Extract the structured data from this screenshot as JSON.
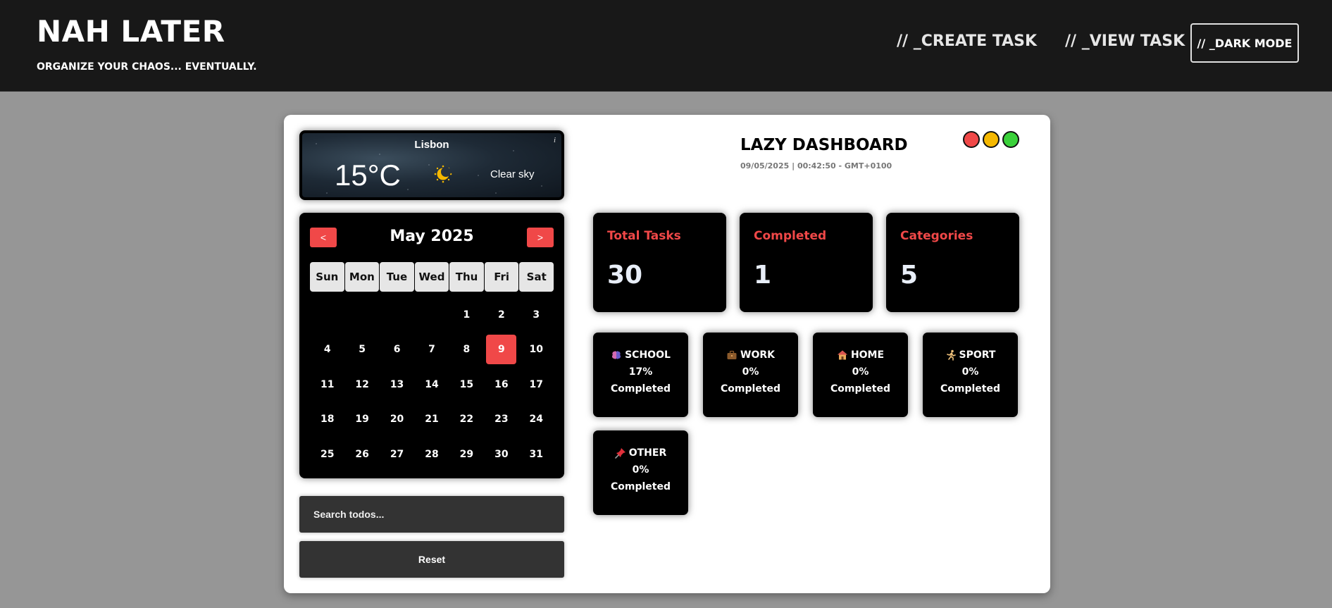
{
  "header": {
    "title": "NAH LATER",
    "tagline": "ORGANIZE YOUR CHAOS... EVENTUALLY.",
    "nav": {
      "create": "// _CREATE TASK",
      "view": "// _VIEW TASK",
      "dark": "// _DARK MODE"
    }
  },
  "weather": {
    "city": "Lisbon",
    "temp": "15°C",
    "description": "Clear sky",
    "icon": "moon-clear-night-icon",
    "info": "i"
  },
  "calendar": {
    "month": "May 2025",
    "prev": "<",
    "next": ">",
    "weekdays": [
      "Sun",
      "Mon",
      "Tue",
      "Wed",
      "Thu",
      "Fri",
      "Sat"
    ],
    "leading_blanks": 4,
    "days": [
      "1",
      "2",
      "3",
      "4",
      "5",
      "6",
      "7",
      "8",
      "9",
      "10",
      "11",
      "12",
      "13",
      "14",
      "15",
      "16",
      "17",
      "18",
      "19",
      "20",
      "21",
      "22",
      "23",
      "24",
      "25",
      "26",
      "27",
      "28",
      "29",
      "30",
      "31"
    ],
    "today": "9"
  },
  "search": {
    "placeholder": "Search todos..."
  },
  "reset_label": "Reset",
  "dashboard": {
    "title": "LAZY DASHBOARD",
    "datetime": "09/05/2025 | 00:42:50 - GMT+0100",
    "window_dots": [
      "#f04848",
      "#f5b800",
      "#3ad13a"
    ]
  },
  "stats": [
    {
      "label": "Total Tasks",
      "value": "30"
    },
    {
      "label": "Completed",
      "value": "1"
    },
    {
      "label": "Categories",
      "value": "5"
    }
  ],
  "categories": [
    {
      "name": "SCHOOL",
      "icon": "brain-icon",
      "percent": "17%",
      "completed": "Completed"
    },
    {
      "name": "WORK",
      "icon": "briefcase-icon",
      "percent": "0%",
      "completed": "Completed"
    },
    {
      "name": "HOME",
      "icon": "house-icon",
      "percent": "0%",
      "completed": "Completed"
    },
    {
      "name": "SPORT",
      "icon": "runner-icon",
      "percent": "0%",
      "completed": "Completed"
    },
    {
      "name": "OTHER",
      "icon": "pushpin-icon",
      "percent": "0%",
      "completed": "Completed"
    }
  ],
  "colors": {
    "accent": "#f04848",
    "header_bg": "#181818",
    "page_bg": "#969696"
  }
}
